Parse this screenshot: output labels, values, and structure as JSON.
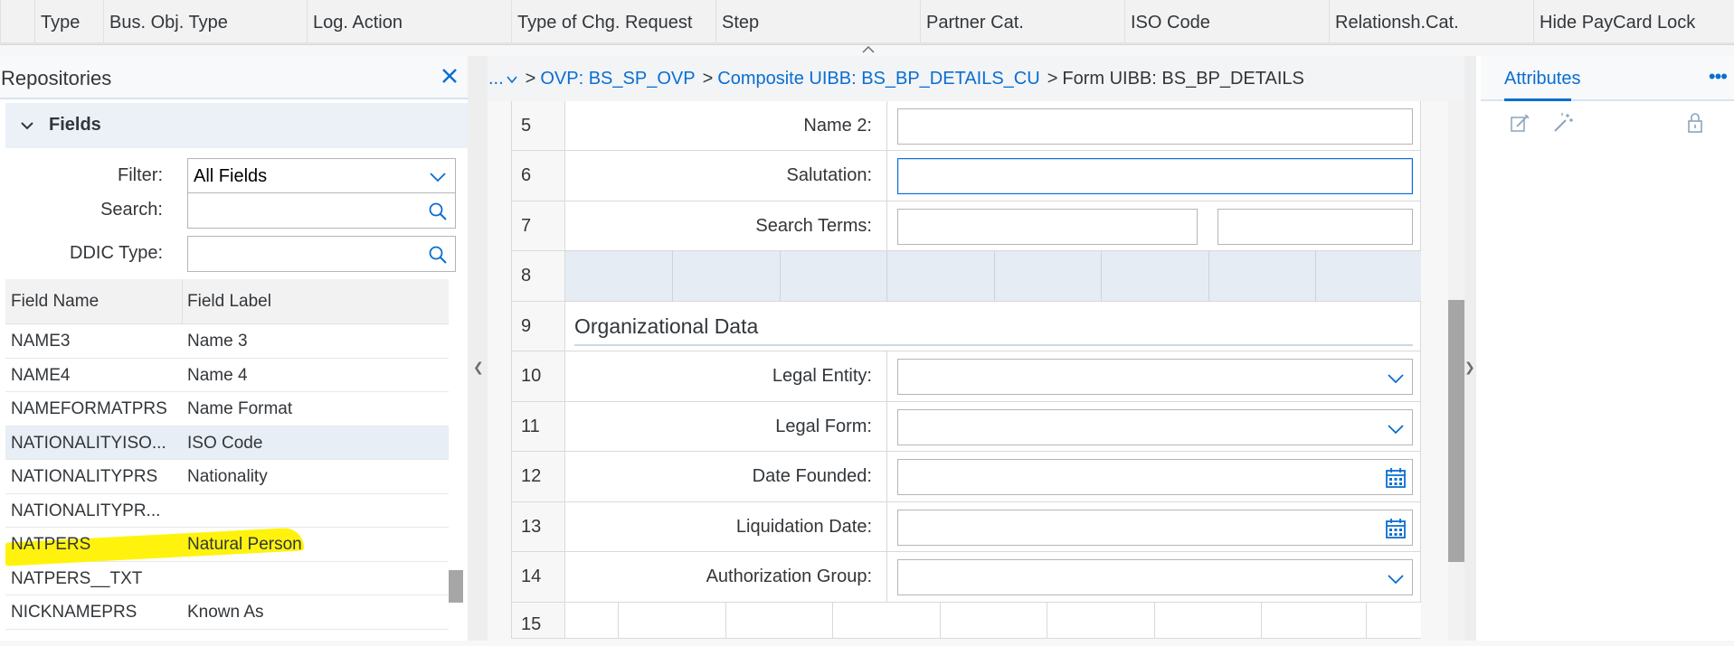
{
  "top_columns": [
    "Type",
    "Bus. Obj. Type",
    "Log. Action",
    "Type of Chg. Request",
    "Step",
    "Partner Cat.",
    "ISO Code",
    "Relationsh.Cat.",
    "Hide PayCard Lock"
  ],
  "repositories": {
    "title": "Repositories",
    "fields_label": "Fields",
    "filter_label": "Filter:",
    "filter_value": "All Fields",
    "search_label": "Search:",
    "search_value": "",
    "ddic_label": "DDIC Type:",
    "ddic_value": "",
    "col_field_name": "Field Name",
    "col_field_label": "Field Label",
    "rows": [
      {
        "name": "NAME3",
        "label": "Name 3"
      },
      {
        "name": "NAME4",
        "label": "Name 4"
      },
      {
        "name": "NAMEFORMATPRS",
        "label": "Name Format"
      },
      {
        "name": "NATIONALITYISO...",
        "label": "ISO Code"
      },
      {
        "name": "NATIONALITYPRS",
        "label": "Nationality"
      },
      {
        "name": "NATIONALITYPR...",
        "label": ""
      },
      {
        "name": "NATPERS",
        "label": "Natural Person"
      },
      {
        "name": "NATPERS__TXT",
        "label": ""
      },
      {
        "name": "NICKNAMEPRS",
        "label": "Known As"
      }
    ]
  },
  "breadcrumb": {
    "ellipsis": "...",
    "ovp": "OVP: BS_SP_OVP",
    "composite": "Composite UIBB: BS_BP_DETAILS_CU",
    "form": "Form UIBB: BS_BP_DETAILS"
  },
  "form_rows": {
    "r5": {
      "num": "5",
      "label": "Name 2:"
    },
    "r6": {
      "num": "6",
      "label": "Salutation:"
    },
    "r7": {
      "num": "7",
      "label": "Search Terms:"
    },
    "r8": {
      "num": "8"
    },
    "r9": {
      "num": "9",
      "section": "Organizational Data"
    },
    "r10": {
      "num": "10",
      "label": "Legal Entity:"
    },
    "r11": {
      "num": "11",
      "label": "Legal Form:"
    },
    "r12": {
      "num": "12",
      "label": "Date Founded:"
    },
    "r13": {
      "num": "13",
      "label": "Liquidation Date:"
    },
    "r14": {
      "num": "14",
      "label": "Authorization Group:"
    },
    "r15": {
      "num": "15"
    }
  },
  "attributes": {
    "tab_label": "Attributes",
    "more": "•••"
  },
  "colors": {
    "link": "#0a6ed1",
    "highlight": "#fff200",
    "selected_row": "#e8eef5"
  }
}
